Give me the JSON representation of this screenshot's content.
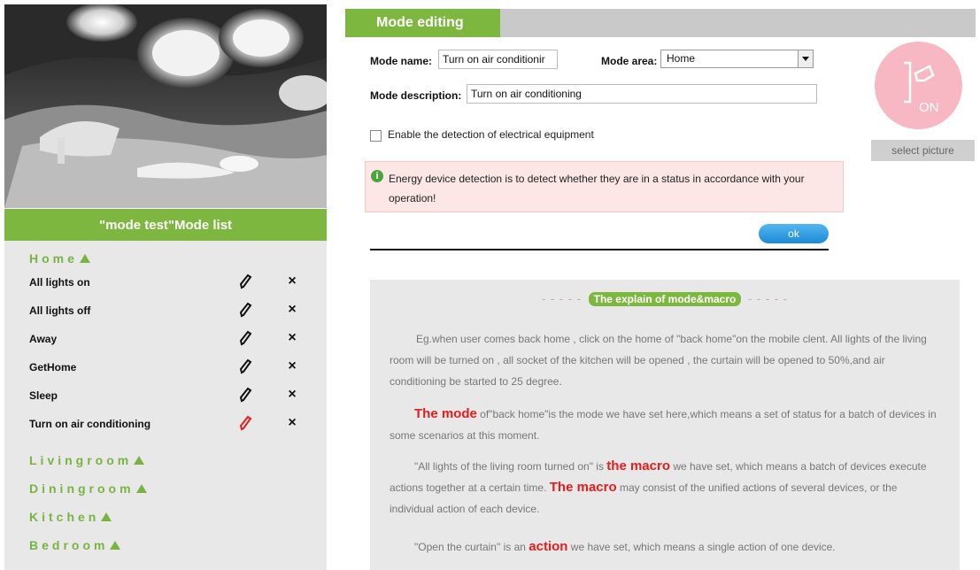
{
  "list_header": "\"mode test\"Mode list",
  "groups": [
    {
      "name": "Home"
    },
    {
      "name": "Livingroom"
    },
    {
      "name": "Diningroom"
    },
    {
      "name": "Kitchen"
    },
    {
      "name": "Bedroom"
    }
  ],
  "modes": [
    {
      "name": "All lights on"
    },
    {
      "name": "All lights off"
    },
    {
      "name": "Away"
    },
    {
      "name": "GetHome"
    },
    {
      "name": "Sleep"
    },
    {
      "name": "Turn on air conditioning"
    }
  ],
  "tab": {
    "title": "Mode editing"
  },
  "form": {
    "mode_name_label": "Mode name:",
    "mode_name_value": "Turn on air conditionir",
    "mode_area_label": "Mode area:",
    "mode_area_value": "Home",
    "mode_desc_label": "Mode description:",
    "mode_desc_value": "Turn on air conditioning",
    "checkbox_label": "Enable the detection of electrical equipment",
    "notice": "Energy device detection is to detect whether they are in a status in accordance with your operation!",
    "ok_label": "ok",
    "picture_label": "ON",
    "select_picture": "select picture"
  },
  "explain": {
    "title_dashes_left": "- - - - -",
    "title": "The explain of  mode&macro",
    "title_dashes_right": "- - - - -",
    "p1": "Eg.when user comes back home , click on the home of \"back home\"on the mobile clent. All lights of the living room will be turned on , all socket of the kitchen will be opened , the curtain will be opened to 50%,and air conditioning be started to 25 degree.",
    "p2_hl": "The mode",
    "p2_rest": " of\"back home\"is the mode we have set here,which means a set of status for a batch of devices in some scenarios at this moment.",
    "p3_a": "\"All lights of the living room turned on\" is ",
    "p3_hl1": "the macro",
    "p3_b": " we have set, which means a batch of devices execute actions together at a certain time. ",
    "p3_hl2": "The macro",
    "p3_c": " may consist of the unified actions of several devices, or the individual action of each device.",
    "p4_a": "\"Open the curtain\" is an ",
    "p4_hl": "action",
    "p4_b": " we have set, which means a single action of one device."
  },
  "colors": {
    "green": "#7db73f",
    "red_highlight": "#e51c1c",
    "ok_blue": "#1e8ad4",
    "pink": "#f7b7c3"
  },
  "icons": [
    "pencil-icon",
    "close-icon",
    "info-icon",
    "switch-picture-icon",
    "chevron-up-icon"
  ]
}
